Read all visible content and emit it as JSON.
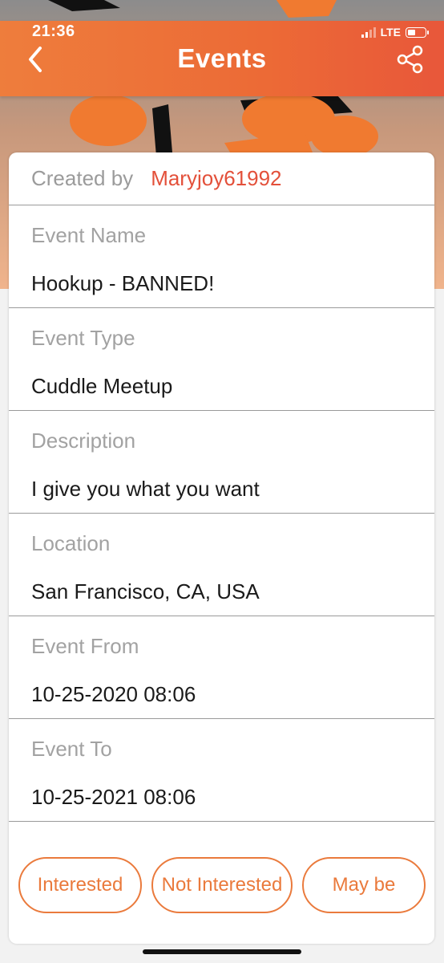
{
  "status_bar": {
    "time": "21:36",
    "network": "LTE",
    "signal_bars": 2,
    "battery_level": 0.4
  },
  "header": {
    "title": "Events",
    "back_icon": "chevron-left-icon",
    "share_icon": "share-icon"
  },
  "created_by": {
    "label": "Created by",
    "username": "Maryjoy61992"
  },
  "fields": [
    {
      "label": "Event Name",
      "value": "Hookup - BANNED!"
    },
    {
      "label": "Event Type",
      "value": "Cuddle Meetup"
    },
    {
      "label": "Description",
      "value": "I give you what you want"
    },
    {
      "label": "Location",
      "value": "San Francisco, CA, USA"
    },
    {
      "label": "Event From",
      "value": "10-25-2020 08:06"
    },
    {
      "label": "Event To",
      "value": "10-25-2021 08:06"
    }
  ],
  "actions": {
    "interested": "Interested",
    "not_interested": "Not Interested",
    "maybe": "May be"
  },
  "colors": {
    "accent": "#ea7a3c",
    "header_start": "#ee7d3c",
    "header_end": "#e8573a",
    "username": "#e3503a"
  }
}
